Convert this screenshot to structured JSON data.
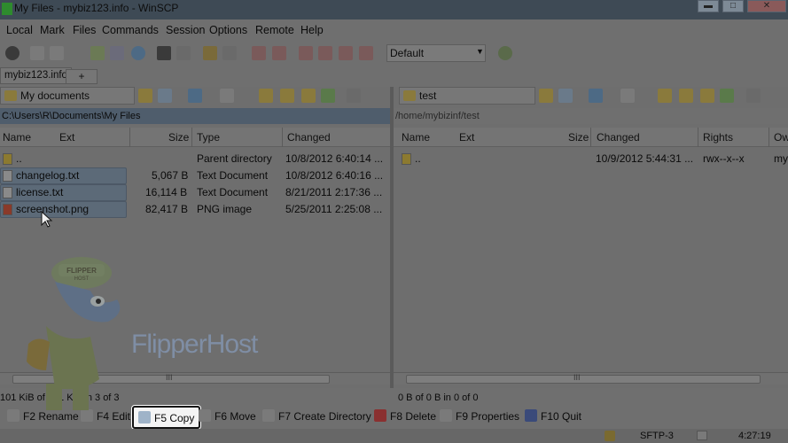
{
  "window": {
    "title": "My Files - mybiz123.info - WinSCP",
    "controls": [
      "minimize",
      "maximize",
      "close"
    ]
  },
  "menu": {
    "items": [
      "Local",
      "Mark",
      "Files",
      "Commands",
      "Session",
      "Options",
      "Remote",
      "Help"
    ]
  },
  "toolbar": {
    "transfer_settings": "Default"
  },
  "tabs": {
    "session": "mybiz123.info",
    "new_tab": "+"
  },
  "left_pane": {
    "location": "My documents",
    "path": "C:\\Users\\R\\Documents\\My Files",
    "columns": [
      "Name",
      "Ext",
      "Size",
      "Type",
      "Changed"
    ],
    "rows": [
      {
        "name": "..",
        "size": "",
        "type": "Parent directory",
        "changed": "10/8/2012  6:40:14 ..."
      },
      {
        "name": "changelog.txt",
        "size": "5,067 B",
        "type": "Text Document",
        "changed": "10/8/2012  6:40:16 ..."
      },
      {
        "name": "license.txt",
        "size": "16,114 B",
        "type": "Text Document",
        "changed": "8/21/2011  2:17:36 ..."
      },
      {
        "name": "screenshot.png",
        "size": "82,417 B",
        "type": "PNG image",
        "changed": "5/25/2011  2:25:08 ..."
      }
    ],
    "status": "101 KiB of 101 KiB in 3 of 3",
    "scroll_thumb_label": "III"
  },
  "right_pane": {
    "location": "test",
    "path": "/home/mybizinf/test",
    "columns": [
      "Name",
      "Ext",
      "Size",
      "Changed",
      "Rights",
      "Ow"
    ],
    "rows": [
      {
        "name": "..",
        "changed": "10/9/2012  5:44:31 ...",
        "rights": "rwx--x--x",
        "owner": "my"
      }
    ],
    "status": "0 B of 0 B in 0 of 0",
    "scroll_thumb_label": "III"
  },
  "commands": {
    "rename": "F2 Rename",
    "edit": "F4 Edit",
    "copy": "F5 Copy",
    "move": "F6 Move",
    "mkdir": "F7 Create Directory",
    "delete": "F8 Delete",
    "properties": "F9 Properties",
    "quit": "F10 Quit"
  },
  "statusbar": {
    "protocol": "SFTP-3",
    "time": "4:27:19"
  },
  "overlay": {
    "watermark": "FlipperHost",
    "mascot_cap": "FLIPPER HOST"
  },
  "colors": {
    "highlight_box_border": "#111111",
    "path_active": "#4f5d6c",
    "selection": "#5c6a78"
  }
}
